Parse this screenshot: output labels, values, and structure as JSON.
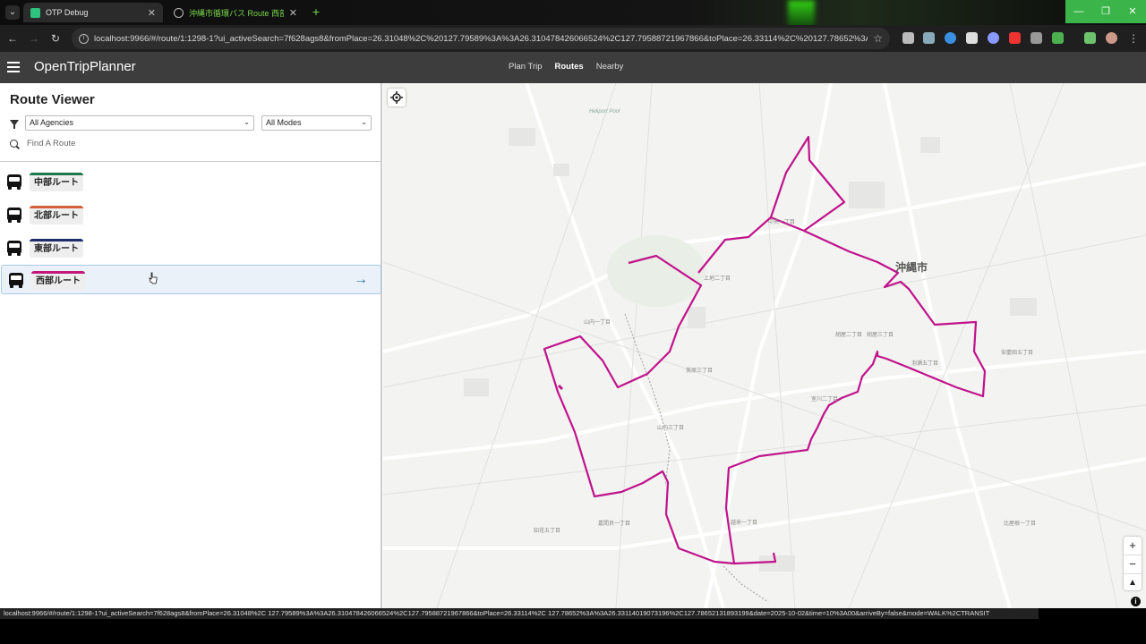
{
  "browser": {
    "tabs": [
      {
        "title": "OTP Debug",
        "active": true
      },
      {
        "title": "沖縄市循環バス Route 西部ル-",
        "active": false
      }
    ],
    "url": "localhost:9966/#/route/1:1298-1?ui_activeSearch=7f628ags8&fromPlace=26.31048%2C%20127.79589%3A%3A26.310478426066524%2C127.79588721967866&toPlace=26.33114%2C%20127.78652%3A%3A2...",
    "status_url": "localhost:9966/#/route/1:1298-1?ui_activeSearch=7f628ags8&fromPlace=26.31048%2C 127.79589%3A%3A26.310478426066524%2C127.79588721967866&toPlace=26.33114%2C 127.78652%3A%3A26.33114019073196%2C127.78652131893199&date=2025-10-02&time=10%3A00&arriveBy=false&mode=WALK%2CTRANSIT"
  },
  "app": {
    "brand": "OpenTripPlanner",
    "nav": [
      {
        "label": "Plan Trip",
        "active": false
      },
      {
        "label": "Routes",
        "active": true
      },
      {
        "label": "Nearby",
        "active": false
      }
    ]
  },
  "sidebar": {
    "title": "Route Viewer",
    "agency_select": "All Agencies",
    "mode_select": "All Modes",
    "search_placeholder": "Find A Route",
    "routes": [
      {
        "label": "中部ルート",
        "color": "#1a7a4a"
      },
      {
        "label": "北部ルート",
        "color": "#d2603a"
      },
      {
        "label": "東部ルート",
        "color": "#1f2b6b"
      },
      {
        "label": "西部ルート",
        "color": "#c2187a"
      }
    ]
  },
  "map": {
    "city_label": "沖縄市",
    "pool_label": "Heliport Pool",
    "route_color": "#c0138b",
    "area_labels": [
      "中央一丁目",
      "上地二丁目",
      "山内一丁目",
      "山内三丁目",
      "胡屋二丁目",
      "泡瀬五丁目",
      "室川二丁目",
      "嘉間良一丁目",
      "安慶田五丁目",
      "比屋根一丁目",
      "胡屋三丁目",
      "美原三丁目",
      "越来一丁目",
      "知花五丁目"
    ],
    "zoom_in": "+",
    "zoom_out": "−",
    "compass": "▲"
  }
}
